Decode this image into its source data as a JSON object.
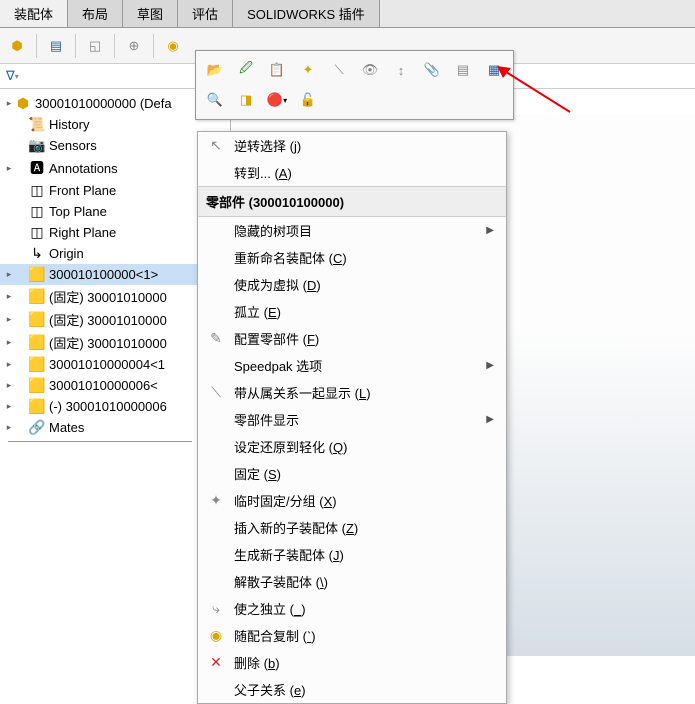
{
  "tabs": [
    "装配体",
    "布局",
    "草图",
    "评估",
    "SOLIDWORKS 插件"
  ],
  "tree": {
    "root": "30001010000000 (Defa",
    "items": [
      {
        "icon": "📜",
        "label": "History",
        "exp": false,
        "sel": false
      },
      {
        "icon": "📷",
        "label": "Sensors",
        "exp": false,
        "sel": false
      },
      {
        "icon": "🅰",
        "label": "Annotations",
        "exp": true,
        "sel": false
      },
      {
        "icon": "◫",
        "label": "Front Plane",
        "exp": false,
        "sel": false
      },
      {
        "icon": "◫",
        "label": "Top Plane",
        "exp": false,
        "sel": false
      },
      {
        "icon": "◫",
        "label": "Right Plane",
        "exp": false,
        "sel": false
      },
      {
        "icon": "↳",
        "label": "Origin",
        "exp": false,
        "sel": false
      },
      {
        "icon": "🟨",
        "label": "300010100000<1>",
        "exp": true,
        "sel": true
      },
      {
        "icon": "🟨",
        "label": "(固定) 30001010000",
        "exp": true,
        "sel": false
      },
      {
        "icon": "🟨",
        "label": "(固定) 30001010000",
        "exp": true,
        "sel": false
      },
      {
        "icon": "🟨",
        "label": "(固定) 30001010000",
        "exp": true,
        "sel": false
      },
      {
        "icon": "🟨",
        "label": "30001010000004<1",
        "exp": true,
        "sel": false
      },
      {
        "icon": "🟨",
        "label": "30001010000006<",
        "exp": true,
        "sel": false
      },
      {
        "icon": "🟨",
        "label": "(-) 30001010000006",
        "exp": true,
        "sel": false
      },
      {
        "icon": "🔗",
        "label": "Mates",
        "exp": true,
        "sel": false
      }
    ]
  },
  "contextMenu": {
    "section1": [
      {
        "icon": "↖",
        "label": "逆转选择",
        "key": "j"
      },
      {
        "icon": "",
        "label": "转到...",
        "key": "A"
      }
    ],
    "header": "零部件 (300010100000)",
    "section2": [
      {
        "icon": "",
        "label": "隐藏的树项目",
        "key": "",
        "sub": true
      },
      {
        "icon": "",
        "label": "重新命名装配体",
        "key": "C"
      },
      {
        "icon": "",
        "label": "使成为虚拟",
        "key": "D"
      },
      {
        "icon": "",
        "label": "孤立",
        "key": "E"
      },
      {
        "icon": "✎",
        "label": "配置零部件",
        "key": "F"
      },
      {
        "icon": "",
        "label": "Speedpak 选项",
        "key": "",
        "sub": true
      },
      {
        "icon": "⟍",
        "label": "带从属关系一起显示",
        "key": "L"
      },
      {
        "icon": "",
        "label": "零部件显示",
        "key": "",
        "sub": true
      },
      {
        "icon": "",
        "label": "设定还原到轻化",
        "key": "Q"
      },
      {
        "icon": "",
        "label": "固定",
        "key": "S"
      },
      {
        "icon": "✦",
        "label": "临时固定/分组",
        "key": "X"
      },
      {
        "icon": "",
        "label": "插入新的子装配体",
        "key": "Z"
      },
      {
        "icon": "",
        "label": "生成新子装配体",
        "key": "J"
      },
      {
        "icon": "",
        "label": "解散子装配体",
        "key": "\\"
      },
      {
        "icon": "⤷",
        "label": "使之独立",
        "key": "_"
      },
      {
        "icon": "◉",
        "label": "随配合复制",
        "key": "`"
      },
      {
        "icon": "✕",
        "label": "删除",
        "key": "b"
      },
      {
        "icon": "",
        "label": "父子关系",
        "key": "e"
      }
    ]
  }
}
